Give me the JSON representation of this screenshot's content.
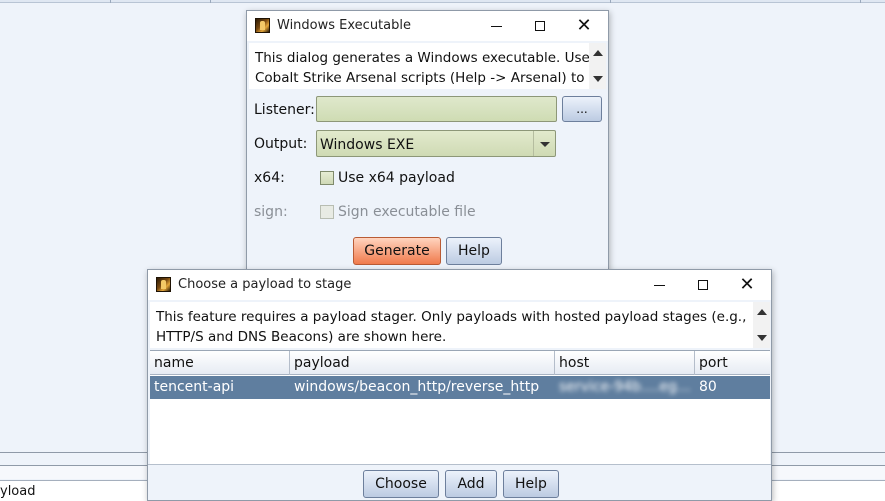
{
  "background": {
    "bottom_text": "yload"
  },
  "exe_dialog": {
    "title": "Windows Executable",
    "icon": "cobalt-strike-icon",
    "description": "This dialog generates a Windows executable. Use\nCobalt Strike Arsenal scripts (Help -> Arsenal) to",
    "listener_label": "Listener:",
    "listener_value": "",
    "browse_label": "...",
    "output_label": "Output:",
    "output_value": "Windows EXE",
    "x64_label": "x64:",
    "x64_checkbox_label": "Use x64 payload",
    "x64_checked": false,
    "sign_label": "sign:",
    "sign_checkbox_label": "Sign executable file",
    "sign_checked": false,
    "generate_label": "Generate",
    "help_label": "Help"
  },
  "stage_dialog": {
    "title": "Choose a payload to stage",
    "icon": "cobalt-strike-icon",
    "description": "This feature requires a payload stager. Only payloads with hosted payload stages (e.g.,\nHTTP/S and DNS Beacons) are shown here.",
    "columns": [
      "name",
      "payload",
      "host",
      "port"
    ],
    "rows": [
      {
        "name": "tencent-api",
        "payload": "windows/beacon_http/reverse_http",
        "host": "service-94b….eg…",
        "port": "80",
        "selected": true
      }
    ],
    "choose_label": "Choose",
    "add_label": "Add",
    "help_label": "Help"
  },
  "colors": {
    "selection": "#5f7e9f",
    "generate_button": "#f07a4c",
    "field_bg": "#d6e0c0"
  }
}
